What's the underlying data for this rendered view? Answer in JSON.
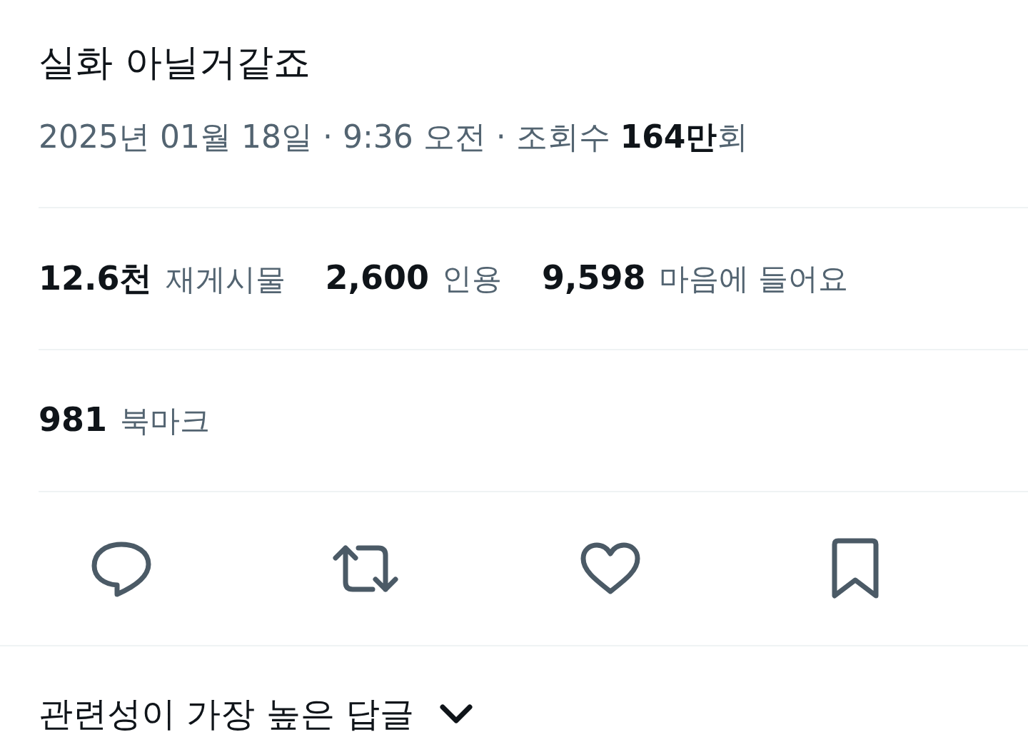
{
  "tweet": {
    "text": "실화 아닐거같죠",
    "meta": "2025년 01월 18일 · 9:36 오전 · 조회수 **164만**회"
  },
  "stats": [
    {
      "count": "12.6천",
      "label": "재게시물"
    },
    {
      "count": "2,600",
      "label": "인용"
    },
    {
      "count": "9,598",
      "label": "마음에 들어요"
    }
  ],
  "bookmarks": {
    "count": "981",
    "label": "북마크"
  },
  "actions": [
    {
      "kind": "reply"
    },
    {
      "kind": "repost"
    },
    {
      "kind": "like"
    },
    {
      "kind": "bookmark"
    }
  ],
  "replies_sort": {
    "label": "관련성이 가장 높은 답글"
  }
}
